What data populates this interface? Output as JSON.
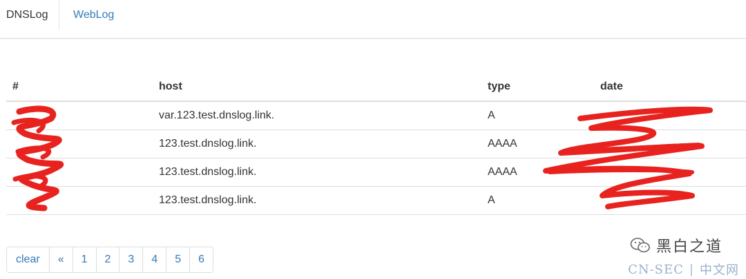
{
  "nav": {
    "tabs": [
      {
        "label": "DNSLog",
        "active": true
      },
      {
        "label": "WebLog",
        "active": false
      }
    ]
  },
  "table": {
    "headers": [
      "#",
      "host",
      "type",
      "date"
    ],
    "rows": [
      {
        "id": "",
        "host": "var.123.test.dnslog.link.",
        "type": "A",
        "date": "",
        "redacted": true
      },
      {
        "id": "",
        "host": "123.test.dnslog.link.",
        "type": "AAAA",
        "date": "",
        "redacted": true
      },
      {
        "id": "",
        "host": "123.test.dnslog.link.",
        "type": "AAAA",
        "date": "",
        "redacted": true
      },
      {
        "id": "",
        "host": "123.test.dnslog.link.",
        "type": "A",
        "date": "",
        "redacted": true
      }
    ]
  },
  "pagination": {
    "items": [
      "clear",
      "«",
      "1",
      "2",
      "3",
      "4",
      "5",
      "6"
    ]
  },
  "watermark": {
    "text": "黑白之道",
    "site_left": "CN-SEC",
    "separator": "|",
    "site_right": "中文网"
  },
  "colors": {
    "link": "#337ab7",
    "redaction": "#e8231f",
    "border": "#dddddd"
  }
}
